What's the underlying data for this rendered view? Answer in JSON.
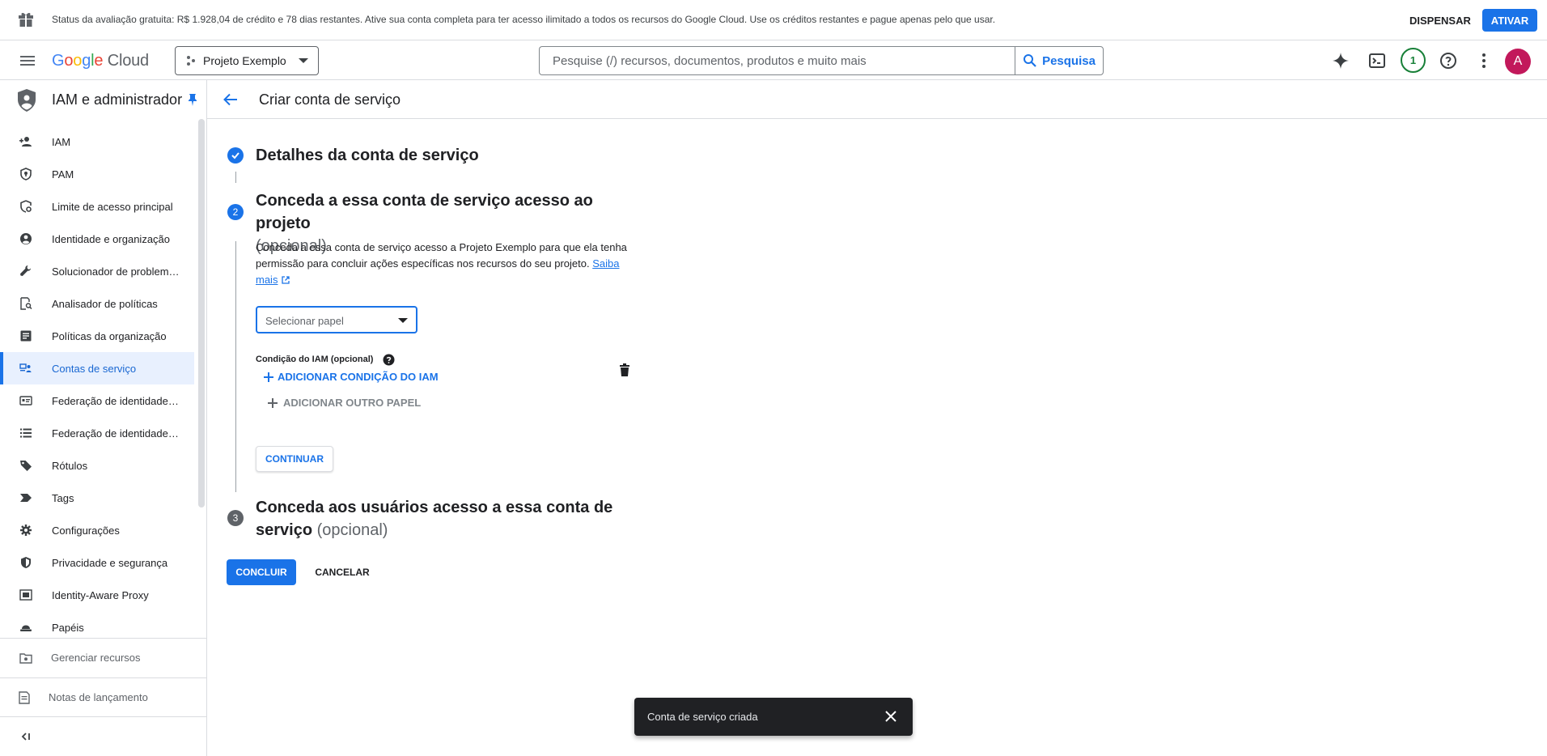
{
  "banner": {
    "text": "Status da avaliação gratuita: R$ 1.928,04 de crédito e 78 dias restantes. Ative sua conta completa para ter acesso ilimitado a todos os recursos do Google Cloud. Use os créditos restantes e pague apenas pelo que usar.",
    "dismiss_label": "DISPENSAR",
    "activate_label": "ATIVAR"
  },
  "topnav": {
    "logo_google": [
      "G",
      "o",
      "o",
      "g",
      "l",
      "e"
    ],
    "logo_cloud": "Cloud",
    "project_name": "Projeto Exemplo",
    "search_placeholder": "Pesquise (/) recursos, documentos, produtos e muito mais",
    "search_button_label": "Pesquisa",
    "notification_count": "1",
    "avatar_initial": "A"
  },
  "sidebar": {
    "title": "IAM e administrador",
    "items": [
      {
        "label": "IAM",
        "icon": "person-add-icon"
      },
      {
        "label": "PAM",
        "icon": "shield-lock-icon"
      },
      {
        "label": "Limite de acesso principal",
        "icon": "shield-gear-icon"
      },
      {
        "label": "Identidade e organização",
        "icon": "account-circle-icon"
      },
      {
        "label": "Solucionador de problemas de política",
        "icon": "wrench-icon"
      },
      {
        "label": "Analisador de políticas",
        "icon": "doc-search-icon"
      },
      {
        "label": "Políticas da organização",
        "icon": "article-icon"
      },
      {
        "label": "Contas de serviço",
        "icon": "service-account-icon",
        "active": true
      },
      {
        "label": "Federação de identidade da carga de trabalho",
        "icon": "id-card-icon"
      },
      {
        "label": "Federação de identidade de colaboradores",
        "icon": "list-icon"
      },
      {
        "label": "Rótulos",
        "icon": "label-icon"
      },
      {
        "label": "Tags",
        "icon": "tag-arrow-icon"
      },
      {
        "label": "Configurações",
        "icon": "gear-icon"
      },
      {
        "label": "Privacidade e segurança",
        "icon": "security-icon"
      },
      {
        "label": "Identity-Aware Proxy",
        "icon": "proxy-icon"
      },
      {
        "label": "Papéis",
        "icon": "hat-icon"
      }
    ],
    "manage_resources": "Gerenciar recursos",
    "release_notes": "Notas de lançamento"
  },
  "page": {
    "title": "Criar conta de serviço",
    "step1_title": "Detalhes da conta de serviço",
    "step2_number": "2",
    "step2_title": "Conceda a essa conta de serviço acesso ao projeto",
    "step2_optional": "(opcional)",
    "step2_desc": "Conceda a essa conta de serviço acesso a Projeto Exemplo para que ela tenha permissão para concluir ações específicas nos recursos do seu projeto.",
    "learn_more_1": "Saiba",
    "learn_more_2": "mais",
    "select_role_label": "Selecionar papel",
    "iam_condition_label": "Condição do IAM (opcional)",
    "add_condition_label": "ADICIONAR CONDIÇÃO DO IAM",
    "add_role_label": "ADICIONAR OUTRO PAPEL",
    "continue_label": "CONTINUAR",
    "step3_number": "3",
    "step3_title_1": "Conceda aos usuários acesso a essa conta de",
    "step3_title_2": "serviço",
    "step3_optional": "(opcional)",
    "done_label": "CONCLUIR",
    "cancel_label": "CANCELAR"
  },
  "snackbar": {
    "message": "Conta de serviço criada"
  },
  "colors": {
    "accent": "#1a73e8",
    "avatar": "#c2185b",
    "notification": "#188038",
    "snackbar": "#202124"
  }
}
